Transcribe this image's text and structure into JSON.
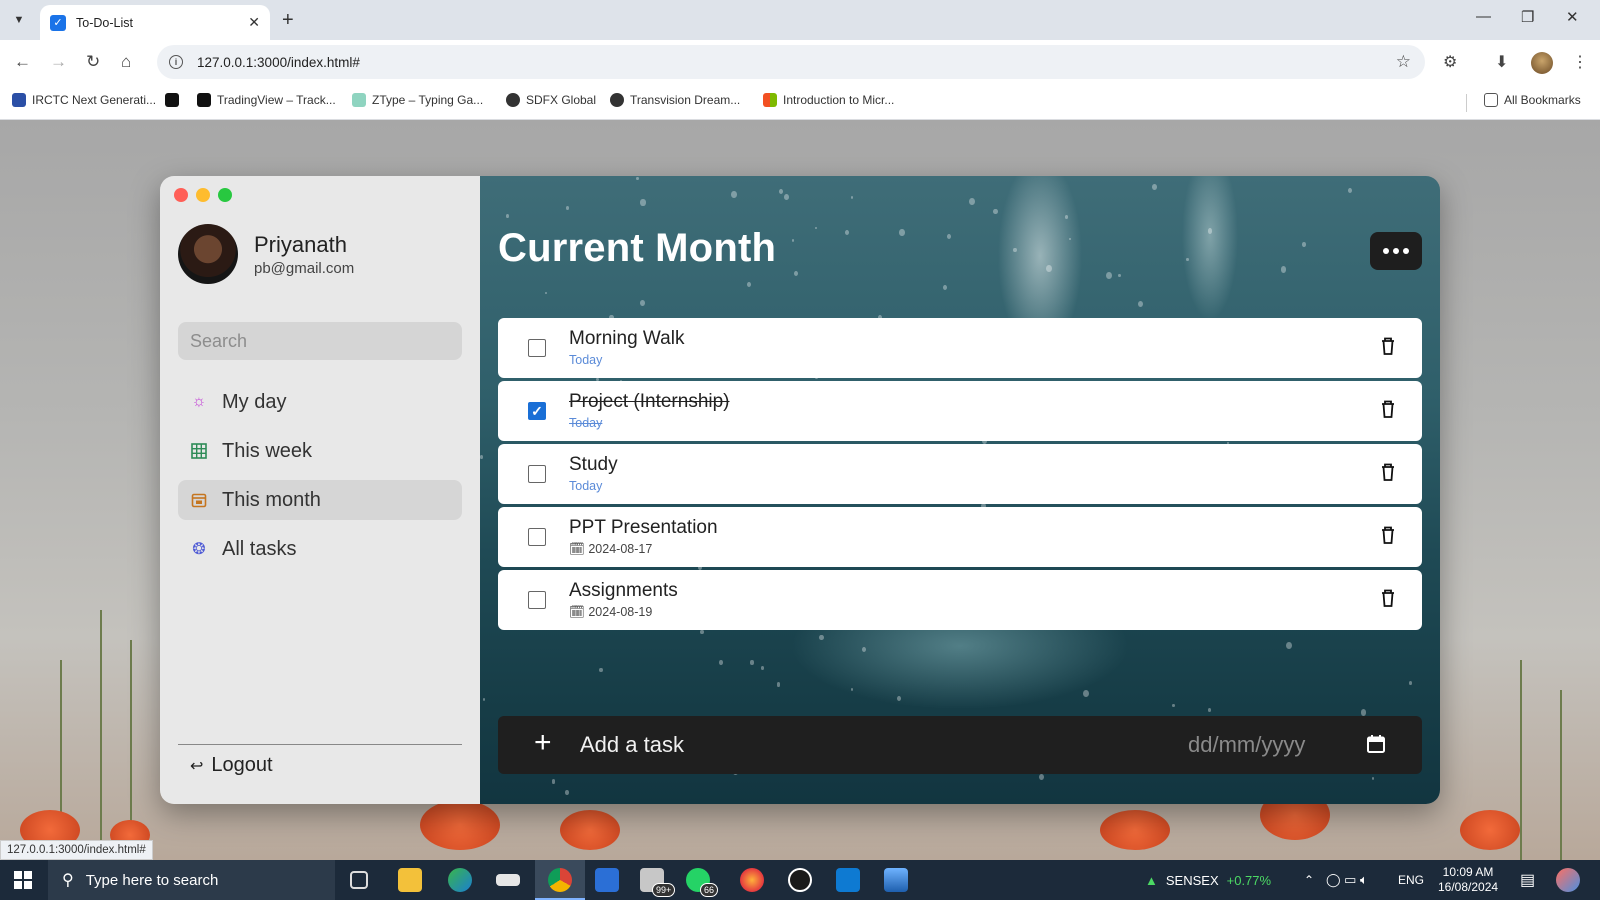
{
  "browser": {
    "tab_title": "To-Do-List",
    "url": "127.0.0.1:3000/index.html#",
    "bookmarks": [
      {
        "label": "IRCTC Next Generati...",
        "icon": "irctc-icon"
      },
      {
        "label": "",
        "icon": "d-icon"
      },
      {
        "label": "TradingView – Track...",
        "icon": "tradingview-icon"
      },
      {
        "label": "ZType – Typing Ga...",
        "icon": "ztype-icon"
      },
      {
        "label": "SDFX Global",
        "icon": "sdfx-icon"
      },
      {
        "label": "Transvision Dream...",
        "icon": "transvision-icon"
      },
      {
        "label": "Introduction to Micr...",
        "icon": "microsoft-icon"
      }
    ],
    "all_bookmarks": "All Bookmarks",
    "status_url": "127.0.0.1:3000/index.html#"
  },
  "sidebar": {
    "user_name": "Priyanath",
    "user_email": "pb@gmail.com",
    "search_placeholder": "Search",
    "nav": [
      {
        "label": "My day",
        "icon": "sun-icon",
        "color": "#c23fd6",
        "active": false
      },
      {
        "label": "This week",
        "icon": "grid-icon",
        "color": "#2e8b57",
        "active": false
      },
      {
        "label": "This month",
        "icon": "calendar-icon",
        "color": "#c5751f",
        "active": true
      },
      {
        "label": "All tasks",
        "icon": "puzzle-icon",
        "color": "#4f5bd5",
        "active": false
      }
    ],
    "logout": "Logout"
  },
  "main": {
    "title": "Current Month",
    "tasks": [
      {
        "name": "Morning Walk",
        "date": "Today",
        "done": false,
        "dated": false
      },
      {
        "name": "Project (Internship)",
        "date": "Today",
        "done": true,
        "dated": false
      },
      {
        "name": "Study",
        "date": "Today",
        "done": false,
        "dated": false
      },
      {
        "name": "PPT Presentation",
        "date": "2024-08-17",
        "done": false,
        "dated": true
      },
      {
        "name": "Assignments",
        "date": "2024-08-19",
        "done": false,
        "dated": true
      }
    ],
    "add_placeholder": "Add a task",
    "date_placeholder": "dd/mm/yyyy"
  },
  "taskbar": {
    "search_placeholder": "Type here to search",
    "badge_mail": "99+",
    "badge_whatsapp": "66",
    "sensex_label": "SENSEX",
    "sensex_change": "+0.77%",
    "language": "ENG",
    "time": "10:09 AM",
    "date": "16/08/2024"
  },
  "colors": {
    "accent": "#1a6fd6",
    "today": "#5b8bd8",
    "sensex_up": "#4cd964"
  }
}
